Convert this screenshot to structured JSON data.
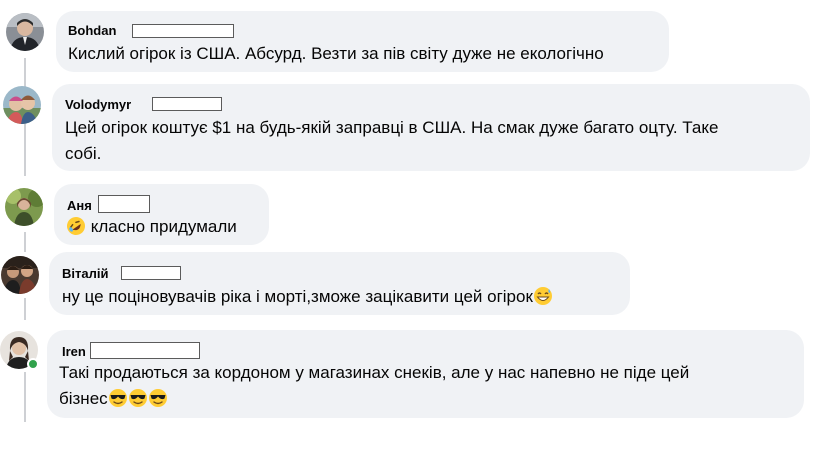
{
  "comments": [
    {
      "author": "Bohdan",
      "text": "Кислий огірок із США. Абсурд. Везти за пів світу дуже не екологічно"
    },
    {
      "author": "Volodymyr",
      "text_line1": "Цей огірок коштує $1 на будь-якій заправці в США. На смак дуже багато оцту. Таке",
      "text_line2": "собі."
    },
    {
      "author": "Аня",
      "text": "класно придумали",
      "emoji": "rolling-laughing-emoji"
    },
    {
      "author": "Віталій",
      "text": "ну це поціновувачів ріка і морті,зможе зацікавити цей огірок",
      "emoji": "grinning-sweat-emoji"
    },
    {
      "author": "Iren",
      "text_line1": "Такі продаються за кордоном у магазинах снеків, але у нас напевно не піде цей",
      "text_line2": "бізнес",
      "emoji": "sunglasses-emoji"
    }
  ],
  "colors": {
    "bubble": "#f0f2f5",
    "thread_line": "#ced0d4",
    "online": "#31a24c"
  }
}
